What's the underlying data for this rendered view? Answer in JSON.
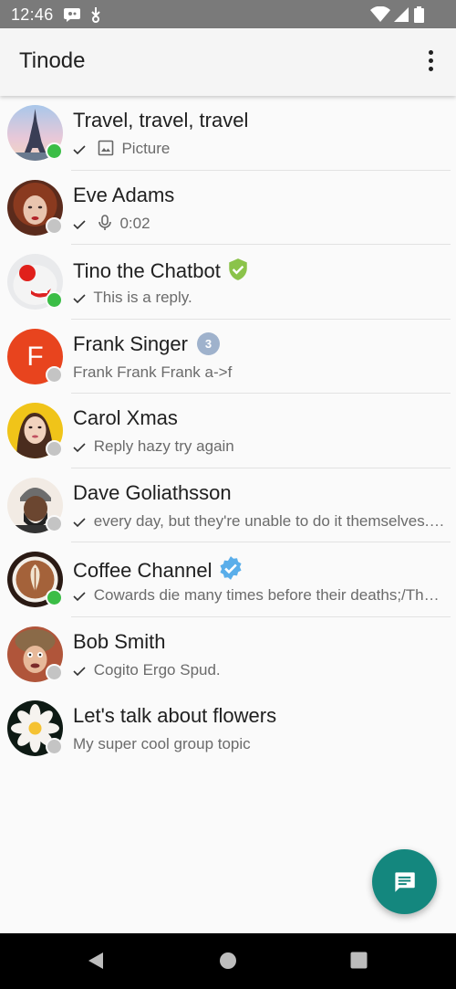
{
  "status_bar": {
    "time": "12:46",
    "icons": [
      "chat-notification-icon",
      "download-icon",
      "wifi-icon",
      "signal-icon",
      "battery-icon"
    ]
  },
  "app_bar": {
    "title": "Tinode",
    "menu_icon": "more-vert-icon"
  },
  "contacts": [
    {
      "name": "Travel, travel, travel",
      "preview": "Picture",
      "read_check": true,
      "attachment_icon": "image-icon",
      "online": true,
      "avatar": "eiffel-tower"
    },
    {
      "name": "Eve Adams",
      "preview": "0:02",
      "read_check": true,
      "attachment_icon": "mic-icon",
      "online": false,
      "avatar": "red-haired-woman"
    },
    {
      "name": "Tino the Chatbot",
      "preview": "This is a reply.",
      "read_check": true,
      "online": true,
      "avatar": "clown-nose",
      "badge": "verified-shield"
    },
    {
      "name": "Frank Singer",
      "preview": "Frank Frank Frank a->f",
      "read_check": false,
      "online": false,
      "avatar_letter": "F",
      "avatar_color": "#e8441e",
      "unread": "3"
    },
    {
      "name": "Carol Xmas",
      "preview": "Reply hazy try again",
      "read_check": true,
      "online": false,
      "avatar": "woman-yellow-bg"
    },
    {
      "name": "Dave Goliathsson",
      "preview": "every day, but they're unable to do it themselves. Never…",
      "read_check": true,
      "online": false,
      "avatar": "bearded-man-beanie"
    },
    {
      "name": "Coffee Channel",
      "preview": "Cowards die many times before their deaths;/The valiant never taste…",
      "read_check": true,
      "online": true,
      "avatar": "latte-art",
      "badge": "verified-blue"
    },
    {
      "name": "Bob Smith",
      "preview": "Cogito Ergo Spud.",
      "read_check": true,
      "online": false,
      "avatar": "man-fur-hat"
    },
    {
      "name": "Let's talk about flowers",
      "preview": "My super cool group topic",
      "read_check": false,
      "online": false,
      "avatar": "water-lily"
    }
  ],
  "fab": {
    "icon": "new-message-icon",
    "color": "#14877e"
  },
  "nav_bar": {
    "icons": [
      "back-icon",
      "home-icon",
      "recents-icon"
    ]
  },
  "colors": {
    "online": "#3bbd46",
    "offline": "#c4c4c4",
    "accent": "#14877e"
  }
}
